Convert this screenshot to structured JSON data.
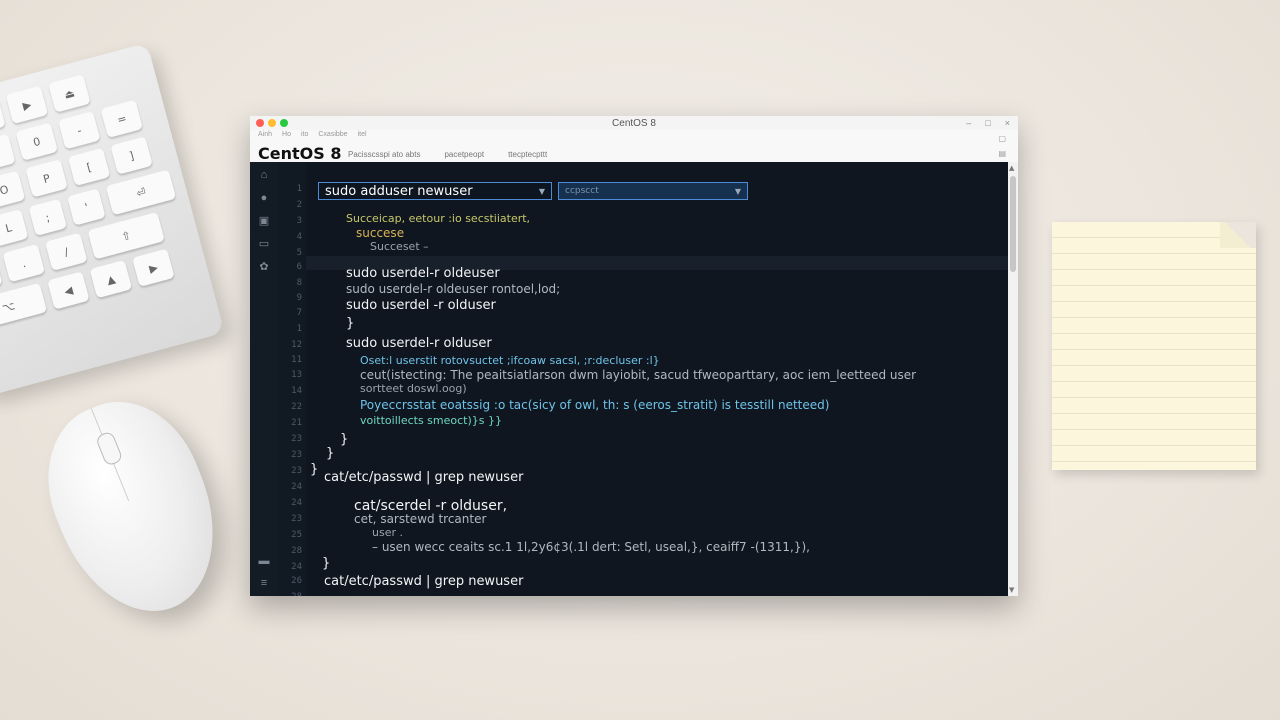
{
  "window": {
    "title": "CentOS 8",
    "app_title": "CentOS 8",
    "small_menu": [
      "Ainh",
      "Ho",
      "ito",
      "Cxasibbe",
      "itel"
    ],
    "tabs": [
      "Pacisscsspi ato abts",
      "pacetpeopt",
      "ttecptecpttt"
    ],
    "controls": [
      "–",
      "□",
      "×"
    ]
  },
  "editor": {
    "line_numbers": [
      "1",
      "2",
      "3",
      "4",
      "5",
      "6",
      "8",
      "9",
      "7",
      "1",
      "12",
      "11",
      "13",
      "14",
      "22",
      "21",
      "23",
      "23",
      "23",
      "24",
      "24",
      "23",
      "25",
      "28",
      "24",
      "26",
      "28",
      "21"
    ],
    "command_box": {
      "value": "sudo adduser newuser"
    },
    "option_box": {
      "value": "ccpscct"
    },
    "lines": [
      {
        "text": "Succeicap, eetour :io secstiiatert,",
        "cls": "c-yellow"
      },
      {
        "text": "succese",
        "cls": "c-gold"
      },
      {
        "text": "Succeset –",
        "cls": "c-dim"
      },
      {
        "text": "sudo userdel-r oldeuser",
        "cls": "c-white"
      },
      {
        "text": "sudo userdel-r oldeuser rontoel,lod;",
        "cls": "c-grey"
      },
      {
        "text": "sudo userdel -r olduser",
        "cls": "c-white"
      },
      {
        "text": "}",
        "cls": "c-white"
      },
      {
        "text": "sudo userdel-r olduser",
        "cls": "c-white"
      },
      {
        "text": "Oset:l  userstit  rotovsuctet  ;ifcoaw sacsl,  ;r:decluser :l}",
        "cls": "c-cyan"
      },
      {
        "text": "ceut(istecting: The peaitsiatlarson dwm layiobit, sacud tfweoparttary, aoc iem_leetteed user",
        "cls": "c-grey"
      },
      {
        "text": "sortteet doswl.oog)",
        "cls": "c-dim"
      },
      {
        "text": "Poyeccrsstat eoatssig :o tac(sicy of owl, th: s (eeros_stratit) is tesstill netteed)",
        "cls": "c-cyan"
      },
      {
        "text": "voittoillects  smeoct)}s }}",
        "cls": "c-teal"
      },
      {
        "text": "}",
        "cls": "c-white"
      },
      {
        "text": "}",
        "cls": "c-white"
      },
      {
        "text": "}",
        "cls": "c-white"
      },
      {
        "text": "cat/etc/passwd | grep newuser",
        "cls": "c-white"
      },
      {
        "text": "cat/scerdel -r olduser,",
        "cls": "c-white"
      },
      {
        "text": "cet, sarstewd  trcanter",
        "cls": "c-grey"
      },
      {
        "text": "user  .",
        "cls": "c-dim"
      },
      {
        "text": "– usen  wecc  ceaits  sc.1  1l,2y6¢3(.1l  dert:  Setl,  useal,},  ceaiff7 -(1311,}),",
        "cls": "c-grey"
      },
      {
        "text": "}",
        "cls": "c-white"
      },
      {
        "text": "cat/etc/passwd | grep newuser",
        "cls": "c-white"
      }
    ]
  }
}
